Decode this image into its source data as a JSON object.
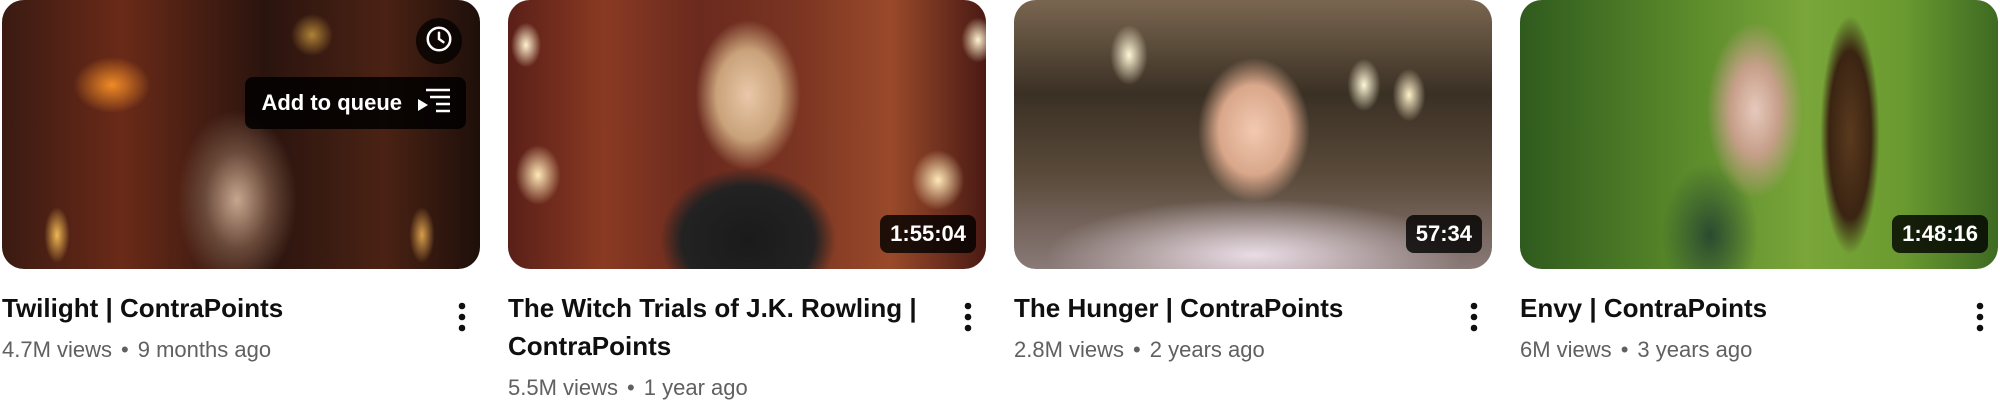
{
  "videos": [
    {
      "title": "Twilight | ContraPoints",
      "views": "4.7M views",
      "age": "9 months ago",
      "duration": "",
      "hover": {
        "queue_label": "Add to queue"
      }
    },
    {
      "title": "The Witch Trials of J.K. Rowling | ContraPoints",
      "views": "5.5M views",
      "age": "1 year ago",
      "duration": "1:55:04"
    },
    {
      "title": "The Hunger | ContraPoints",
      "views": "2.8M views",
      "age": "2 years ago",
      "duration": "57:34"
    },
    {
      "title": "Envy | ContraPoints",
      "views": "6M views",
      "age": "3 years ago",
      "duration": "1:48:16"
    }
  ],
  "separator": "•",
  "icons": {
    "watch_later": "clock-icon",
    "queue": "playlist-add-icon",
    "menu": "more-vertical-icon"
  }
}
